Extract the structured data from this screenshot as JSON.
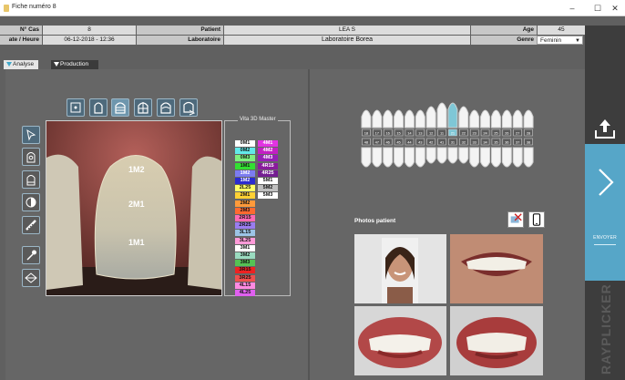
{
  "window": {
    "title": "Fiche numéro 8",
    "minimize": "–",
    "maximize": "☐",
    "close": "✕"
  },
  "info": {
    "case_label": "N° Cas",
    "case_value": "8",
    "patient_label": "Patient",
    "patient_value": "LEA S",
    "age_label": "Age",
    "age_value": "45",
    "date_label": "ate / Heure",
    "date_value": "06-12-2018 - 12:36",
    "lab_label": "Laboratoire",
    "lab_value": "Laboratoire Borea",
    "genre_label": "Genre",
    "genre_value": "Feminin"
  },
  "tabs": {
    "analyse": "Analyse",
    "production": "Production"
  },
  "sidebar": {
    "send_label": "ENVOYER",
    "brand": "RAYPLICKER"
  },
  "legend": {
    "title": "Vita 3D Master",
    "col1": [
      "0M1",
      "0M2",
      "0M3",
      "1M1",
      "1M2",
      "1M2",
      "2L25",
      "2M1",
      "2M2",
      "2M3",
      "2R15",
      "2R25",
      "3L15",
      "3L25",
      "3M1",
      "3M2",
      "3M3",
      "3R15",
      "3R25",
      "4L15",
      "4L25"
    ],
    "col2": [
      "4M1",
      "4M2",
      "4M3",
      "4R15",
      "4R25",
      "5M1",
      "5M2",
      "5M3"
    ]
  },
  "photo_labels": {
    "top": "1M2",
    "middle": "2M1",
    "bottom": "1M1"
  },
  "tooth_numbers_upper": [
    "18",
    "17",
    "16",
    "15",
    "14",
    "13",
    "12",
    "11",
    "21",
    "22",
    "23",
    "24",
    "25",
    "26",
    "27",
    "28"
  ],
  "tooth_numbers_lower": [
    "48",
    "47",
    "46",
    "45",
    "44",
    "43",
    "42",
    "41",
    "31",
    "32",
    "33",
    "34",
    "35",
    "36",
    "37",
    "38"
  ],
  "photos": {
    "title": "Photos patient"
  },
  "colors": {
    "accent": "#56a6c8",
    "selected_tooth": "#7fc7d6"
  }
}
